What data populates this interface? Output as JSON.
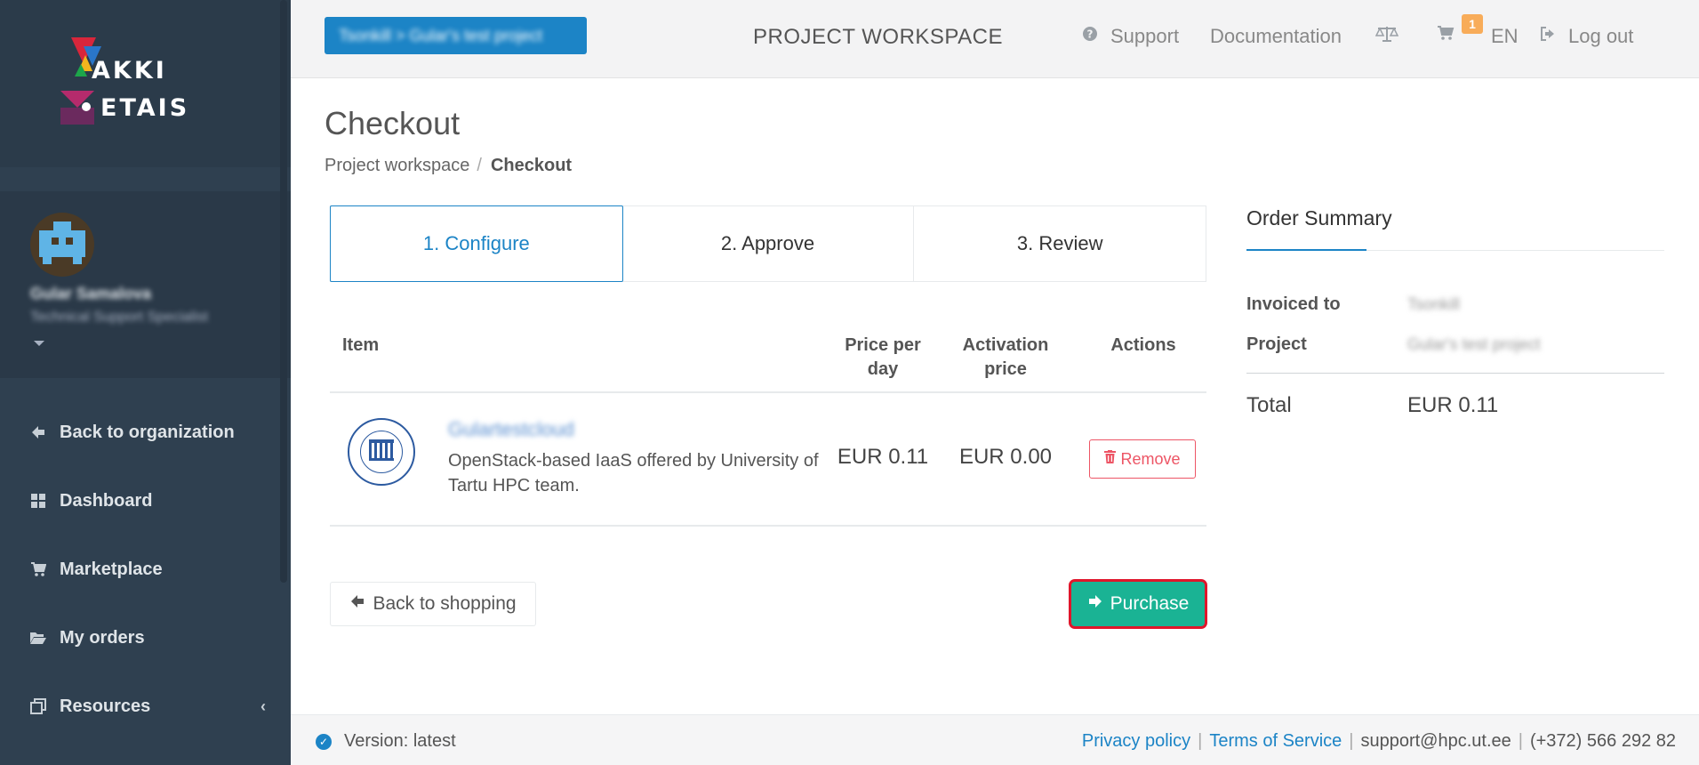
{
  "brand": {
    "line1": "AKKI",
    "line2": "ETAIS"
  },
  "profile": {
    "name": "Gular Samalova",
    "role": "Technical Support Specialist"
  },
  "sidebar": {
    "items": [
      {
        "label": "Back to organization",
        "icon": "arrow-left-icon"
      },
      {
        "label": "Dashboard",
        "icon": "grid-icon"
      },
      {
        "label": "Marketplace",
        "icon": "cart-icon"
      },
      {
        "label": "My orders",
        "icon": "folder-open-icon"
      },
      {
        "label": "Resources",
        "icon": "copy-icon"
      }
    ]
  },
  "topbar": {
    "project_selector": "Tsonkill > Gular's test project",
    "workspace_title": "PROJECT WORKSPACE",
    "support": "Support",
    "documentation": "Documentation",
    "cart_count": "1",
    "language": "EN",
    "logout": "Log out"
  },
  "page": {
    "title": "Checkout",
    "breadcrumb": {
      "parent": "Project workspace",
      "separator": "/",
      "current": "Checkout"
    }
  },
  "steps": [
    "1. Configure",
    "2. Approve",
    "3. Review"
  ],
  "table": {
    "headers": {
      "item": "Item",
      "price_per_day_1": "Price per",
      "price_per_day_2": "day",
      "activation_1": "Activation",
      "activation_2": "price",
      "actions": "Actions"
    },
    "rows": [
      {
        "name": "Gulartestcloud",
        "description": "OpenStack-based IaaS offered by University of Tartu HPC team.",
        "price_per_day": "EUR 0.11",
        "activation_price": "EUR 0.00",
        "remove_label": "Remove"
      }
    ]
  },
  "actions": {
    "back_label": "Back to shopping",
    "purchase_label": "Purchase"
  },
  "summary": {
    "title": "Order Summary",
    "invoiced_to_label": "Invoiced to",
    "invoiced_to_value": "Tsonkill",
    "project_label": "Project",
    "project_value": "Gular's test project",
    "total_label": "Total",
    "total_value": "EUR 0.11"
  },
  "footer": {
    "version": "Version: latest",
    "privacy": "Privacy policy",
    "terms": "Terms of Service",
    "email": "support@hpc.ut.ee",
    "phone": "(+372) 566 292 82"
  },
  "colors": {
    "sidebar": "#2f4050",
    "primary": "#1c84c6",
    "success": "#1ab394",
    "danger": "#ed5565",
    "badge": "#f8ac59"
  }
}
